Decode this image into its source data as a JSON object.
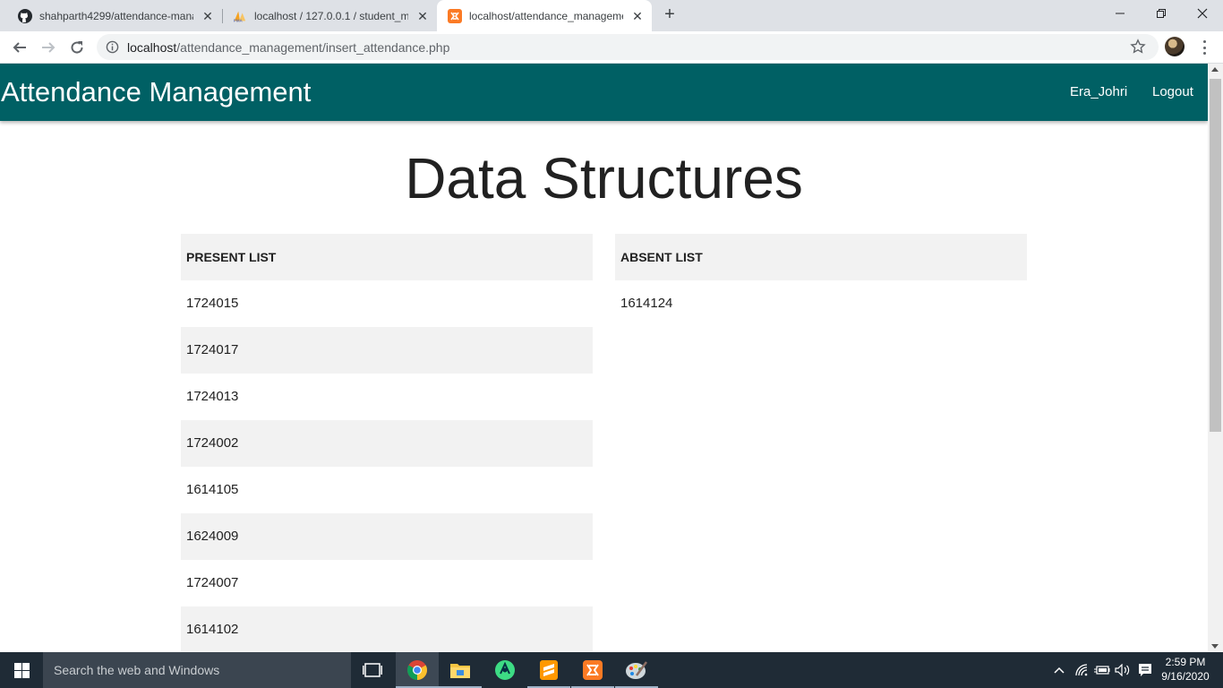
{
  "browser": {
    "tabs": [
      {
        "title": "shahparth4299/attendance-mana",
        "icon": "github-icon",
        "active": false
      },
      {
        "title": "localhost / 127.0.0.1 / student_ma",
        "icon": "phpmyadmin-icon",
        "active": false
      },
      {
        "title": "localhost/attendance_manageme",
        "icon": "xampp-icon",
        "active": true
      }
    ],
    "url_host": "localhost",
    "url_path": "/attendance_management/insert_attendance.php"
  },
  "app": {
    "brand": "Attendance Management",
    "user": "Era_Johri",
    "logout": "Logout",
    "header_color": "#006064"
  },
  "page": {
    "subject_title": "Data Structures",
    "present_header": "PRESENT LIST",
    "absent_header": "ABSENT LIST",
    "present": [
      "1724015",
      "1724017",
      "1724013",
      "1724002",
      "1614105",
      "1624009",
      "1724007",
      "1614102"
    ],
    "absent": [
      "1614124"
    ]
  },
  "taskbar": {
    "search_placeholder": "Search the web and Windows",
    "time": "2:59 PM",
    "date": "9/16/2020",
    "apps": [
      "task-view-icon",
      "chrome-icon",
      "file-explorer-icon",
      "android-studio-icon",
      "sublime-text-icon",
      "xampp-icon",
      "paint-icon"
    ]
  }
}
